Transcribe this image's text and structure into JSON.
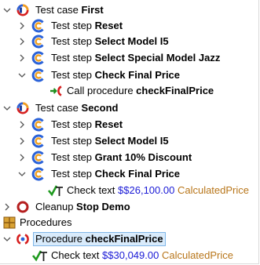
{
  "tree": {
    "test_case_first": {
      "prefix": "Test case ",
      "name": "First"
    },
    "first_steps": [
      {
        "prefix": "Test step ",
        "name": "Reset"
      },
      {
        "prefix": "Test step ",
        "name": "Select Model I5"
      },
      {
        "prefix": "Test step ",
        "name": "Select Special Model Jazz"
      },
      {
        "prefix": "Test step ",
        "name": "Check Final Price"
      }
    ],
    "call_procedure": {
      "prefix": "Call procedure ",
      "name": "checkFinalPrice"
    },
    "test_case_second": {
      "prefix": "Test case ",
      "name": "Second"
    },
    "second_steps": [
      {
        "prefix": "Test step ",
        "name": "Reset"
      },
      {
        "prefix": "Test step ",
        "name": "Select Model I5"
      },
      {
        "prefix": "Test step ",
        "name": "Grant 10% Discount"
      },
      {
        "prefix": "Test step ",
        "name": "Check Final Price"
      }
    ],
    "check_text_second": {
      "prefix": "Check text ",
      "value": "$$26,100.00",
      "component": "CalculatedPrice"
    },
    "cleanup": {
      "prefix": "Cleanup ",
      "name": "Stop Demo"
    },
    "procedures": {
      "label": "Procedures"
    },
    "procedure": {
      "prefix": "Procedure ",
      "name": "checkFinalPrice"
    },
    "check_text_procedure": {
      "prefix": "Check text ",
      "value": "$$30,049.00",
      "component": "CalculatedPrice"
    }
  },
  "colors": {
    "value_blue": "#1a1ad6",
    "component_gold": "#b8761a",
    "selection_bg": "#d9ebfb",
    "selection_border": "#7fb6e8"
  },
  "icons": {
    "test_case": "test-case-icon",
    "test_step": "test-step-icon",
    "call_procedure": "call-procedure-icon",
    "check_text": "check-text-icon",
    "cleanup": "cleanup-icon",
    "procedures": "procedures-package-icon",
    "procedure": "procedure-icon",
    "expanded": "chevron-down-icon",
    "collapsed": "chevron-right-icon"
  }
}
